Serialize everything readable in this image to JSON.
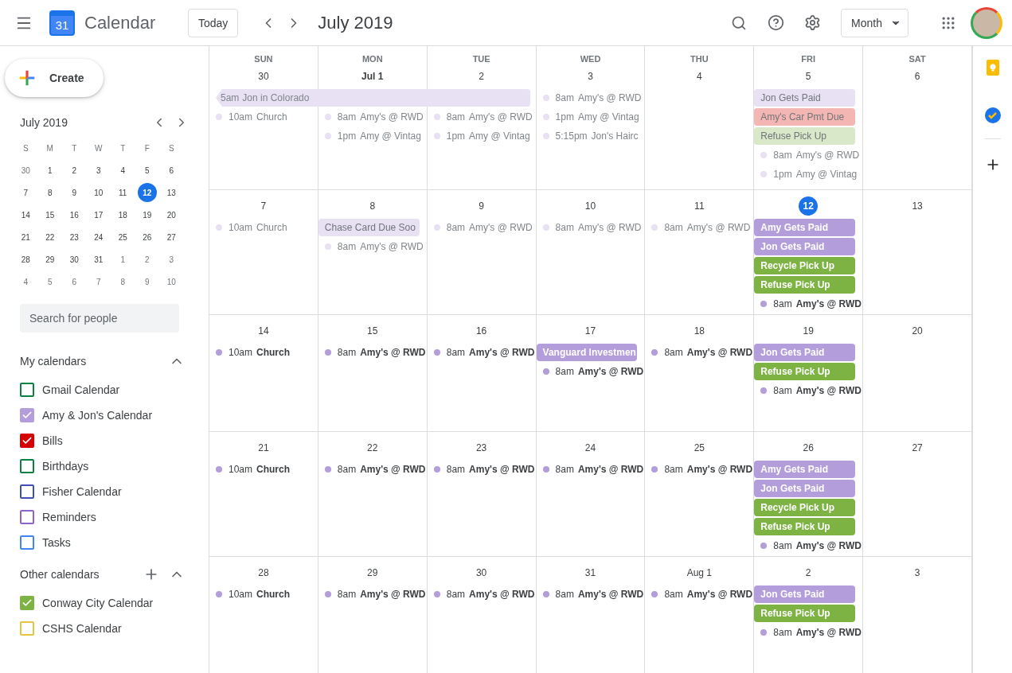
{
  "header": {
    "logo_number": "31",
    "app_name": "Calendar",
    "today_button": "Today",
    "period": "July 2019",
    "view": "Month"
  },
  "sidebar": {
    "create": "Create",
    "mini_calendar": {
      "title": "July 2019",
      "weekdays": [
        "S",
        "M",
        "T",
        "W",
        "T",
        "F",
        "S"
      ],
      "days": [
        {
          "label": "30",
          "other_month": true,
          "selected": false
        },
        {
          "label": "1",
          "other_month": false,
          "selected": false
        },
        {
          "label": "2",
          "other_month": false,
          "selected": false
        },
        {
          "label": "3",
          "other_month": false,
          "selected": false
        },
        {
          "label": "4",
          "other_month": false,
          "selected": false
        },
        {
          "label": "5",
          "other_month": false,
          "selected": false
        },
        {
          "label": "6",
          "other_month": false,
          "selected": false
        },
        {
          "label": "7",
          "other_month": false,
          "selected": false
        },
        {
          "label": "8",
          "other_month": false,
          "selected": false
        },
        {
          "label": "9",
          "other_month": false,
          "selected": false
        },
        {
          "label": "10",
          "other_month": false,
          "selected": false
        },
        {
          "label": "11",
          "other_month": false,
          "selected": false
        },
        {
          "label": "12",
          "other_month": false,
          "selected": true
        },
        {
          "label": "13",
          "other_month": false,
          "selected": false
        },
        {
          "label": "14",
          "other_month": false,
          "selected": false
        },
        {
          "label": "15",
          "other_month": false,
          "selected": false
        },
        {
          "label": "16",
          "other_month": false,
          "selected": false
        },
        {
          "label": "17",
          "other_month": false,
          "selected": false
        },
        {
          "label": "18",
          "other_month": false,
          "selected": false
        },
        {
          "label": "19",
          "other_month": false,
          "selected": false
        },
        {
          "label": "20",
          "other_month": false,
          "selected": false
        },
        {
          "label": "21",
          "other_month": false,
          "selected": false
        },
        {
          "label": "22",
          "other_month": false,
          "selected": false
        },
        {
          "label": "23",
          "other_month": false,
          "selected": false
        },
        {
          "label": "24",
          "other_month": false,
          "selected": false
        },
        {
          "label": "25",
          "other_month": false,
          "selected": false
        },
        {
          "label": "26",
          "other_month": false,
          "selected": false
        },
        {
          "label": "27",
          "other_month": false,
          "selected": false
        },
        {
          "label": "28",
          "other_month": false,
          "selected": false
        },
        {
          "label": "29",
          "other_month": false,
          "selected": false
        },
        {
          "label": "30",
          "other_month": false,
          "selected": false
        },
        {
          "label": "31",
          "other_month": false,
          "selected": false
        },
        {
          "label": "1",
          "other_month": true,
          "selected": false
        },
        {
          "label": "2",
          "other_month": true,
          "selected": false
        },
        {
          "label": "3",
          "other_month": true,
          "selected": false
        },
        {
          "label": "4",
          "other_month": true,
          "selected": false
        },
        {
          "label": "5",
          "other_month": true,
          "selected": false
        },
        {
          "label": "6",
          "other_month": true,
          "selected": false
        },
        {
          "label": "7",
          "other_month": true,
          "selected": false
        },
        {
          "label": "8",
          "other_month": true,
          "selected": false
        },
        {
          "label": "9",
          "other_month": true,
          "selected": false
        },
        {
          "label": "10",
          "other_month": true,
          "selected": false
        }
      ]
    },
    "search": {
      "placeholder": "Search for people"
    },
    "groups": [
      {
        "title": "My calendars",
        "expanded": true,
        "calendars": [
          {
            "name": "Gmail Calendar",
            "color": "#0b8043",
            "checked": false
          },
          {
            "name": "Amy & Jon's Calendar",
            "color": "#b39ddb",
            "checked": true
          },
          {
            "name": "Bills",
            "color": "#d50000",
            "checked": true
          },
          {
            "name": "Birthdays",
            "color": "#0b8043",
            "checked": false
          },
          {
            "name": "Fisher Calendar",
            "color": "#3f51b5",
            "checked": false
          },
          {
            "name": "Reminders",
            "color": "#8e63ce",
            "checked": false
          },
          {
            "name": "Tasks",
            "color": "#4285f4",
            "checked": false
          }
        ]
      },
      {
        "title": "Other calendars",
        "expanded": true,
        "add_button": true,
        "calendars": [
          {
            "name": "Conway City Calendar",
            "color": "#7cb342",
            "checked": true
          },
          {
            "name": "CSHS Calendar",
            "color": "#e4c441",
            "checked": false
          }
        ]
      }
    ]
  },
  "month": {
    "weekdays": [
      "SUN",
      "MON",
      "TUE",
      "WED",
      "THU",
      "FRI",
      "SAT"
    ],
    "weeks": [
      {
        "days": [
          {
            "date": "30",
            "today": false,
            "events": [
              {
                "kind": "span",
                "time": "5am",
                "title": "Jon in Colorado",
                "color": "#e8e1f4",
                "past": true
              },
              {
                "kind": "dot",
                "time": "10am",
                "title": "Church",
                "color": "#e8e1f4",
                "past": true
              }
            ]
          },
          {
            "date": "Jul 1",
            "today": false,
            "events": [
              {
                "kind": "continued",
                "color": "#e8e1f4"
              },
              {
                "kind": "dot",
                "time": "8am",
                "title": "Amy's @ RWD",
                "color": "#e8e1f4",
                "past": true
              },
              {
                "kind": "dot",
                "time": "1pm",
                "title": "Amy @ Vintag",
                "color": "#e8e1f4",
                "past": true
              }
            ]
          },
          {
            "date": "2",
            "today": false,
            "events": [
              {
                "kind": "continued",
                "color": "#e8e1f4"
              },
              {
                "kind": "dot",
                "time": "8am",
                "title": "Amy's @ RWD",
                "color": "#e8e1f4",
                "past": true
              },
              {
                "kind": "dot",
                "time": "1pm",
                "title": "Amy @ Vintag",
                "color": "#e8e1f4",
                "past": true
              }
            ]
          },
          {
            "date": "3",
            "today": false,
            "events": [
              {
                "kind": "dot",
                "time": "8am",
                "title": "Amy's @ RWD",
                "color": "#e8e1f4",
                "past": true
              },
              {
                "kind": "dot",
                "time": "1pm",
                "title": "Amy @ Vintag",
                "color": "#e8e1f4",
                "past": true
              },
              {
                "kind": "dot",
                "time": "5:15pm",
                "title": "Jon's Hairc",
                "color": "#e8e1f4",
                "past": true
              }
            ]
          },
          {
            "date": "4",
            "today": false
          },
          {
            "date": "5",
            "today": false,
            "events": [
              {
                "kind": "chip",
                "title": "Jon Gets Paid",
                "color": "#e8e1f4",
                "past": true
              },
              {
                "kind": "chip",
                "title": "Amy's Car Pmt Due",
                "color": "#f4b6b2",
                "past": true
              },
              {
                "kind": "chip",
                "title": "Refuse Pick Up",
                "color": "#d8e8c8",
                "past": true
              },
              {
                "kind": "dot",
                "time": "8am",
                "title": "Amy's @ RWD",
                "color": "#e8e1f4",
                "past": true
              },
              {
                "kind": "dot",
                "time": "1pm",
                "title": "Amy @ Vintag",
                "color": "#e8e1f4",
                "past": true
              }
            ]
          },
          {
            "date": "6",
            "today": false
          }
        ]
      },
      {
        "days": [
          {
            "date": "7",
            "today": false,
            "events": [
              {
                "kind": "dot",
                "time": "10am",
                "title": "Church",
                "color": "#e8e1f4",
                "past": true
              }
            ]
          },
          {
            "date": "8",
            "today": false,
            "events": [
              {
                "kind": "chip",
                "title": "Chase Card Due Soo",
                "color": "#e8e1f4",
                "past": true
              },
              {
                "kind": "dot",
                "time": "8am",
                "title": "Amy's @ RWD",
                "color": "#e8e1f4",
                "past": true
              }
            ]
          },
          {
            "date": "9",
            "today": false,
            "events": [
              {
                "kind": "dot",
                "time": "8am",
                "title": "Amy's @ RWD",
                "color": "#e8e1f4",
                "past": true
              }
            ]
          },
          {
            "date": "10",
            "today": false,
            "events": [
              {
                "kind": "dot",
                "time": "8am",
                "title": "Amy's @ RWD",
                "color": "#e8e1f4",
                "past": true
              }
            ]
          },
          {
            "date": "11",
            "today": false,
            "events": [
              {
                "kind": "dot",
                "time": "8am",
                "title": "Amy's @ RWD",
                "color": "#e8e1f4",
                "past": true
              }
            ]
          },
          {
            "date": "12",
            "today": true,
            "events": [
              {
                "kind": "chip",
                "title": "Amy Gets Paid",
                "color": "#b39ddb",
                "past": false
              },
              {
                "kind": "chip",
                "title": "Jon Gets Paid",
                "color": "#b39ddb",
                "past": false
              },
              {
                "kind": "chip",
                "title": "Recycle Pick Up",
                "color": "#7cb342",
                "past": false
              },
              {
                "kind": "chip",
                "title": "Refuse Pick Up",
                "color": "#7cb342",
                "past": false
              },
              {
                "kind": "dot",
                "time": "8am",
                "title": "Amy's @ RWD",
                "color": "#b39ddb",
                "past": false
              }
            ]
          },
          {
            "date": "13",
            "today": false
          }
        ]
      },
      {
        "days": [
          {
            "date": "14",
            "today": false,
            "events": [
              {
                "kind": "dot",
                "time": "10am",
                "title": "Church",
                "color": "#b39ddb",
                "past": false
              }
            ]
          },
          {
            "date": "15",
            "today": false,
            "events": [
              {
                "kind": "dot",
                "time": "8am",
                "title": "Amy's @ RWD",
                "color": "#b39ddb",
                "past": false
              }
            ]
          },
          {
            "date": "16",
            "today": false,
            "events": [
              {
                "kind": "dot",
                "time": "8am",
                "title": "Amy's @ RWD",
                "color": "#b39ddb",
                "past": false
              }
            ]
          },
          {
            "date": "17",
            "today": false,
            "events": [
              {
                "kind": "chip",
                "title": "Vanguard Investmen",
                "color": "#b39ddb",
                "past": false
              },
              {
                "kind": "dot",
                "time": "8am",
                "title": "Amy's @ RWD",
                "color": "#b39ddb",
                "past": false
              }
            ]
          },
          {
            "date": "18",
            "today": false,
            "events": [
              {
                "kind": "dot",
                "time": "8am",
                "title": "Amy's @ RWD",
                "color": "#b39ddb",
                "past": false
              }
            ]
          },
          {
            "date": "19",
            "today": false,
            "events": [
              {
                "kind": "chip",
                "title": "Jon Gets Paid",
                "color": "#b39ddb",
                "past": false
              },
              {
                "kind": "chip",
                "title": "Refuse Pick Up",
                "color": "#7cb342",
                "past": false
              },
              {
                "kind": "dot",
                "time": "8am",
                "title": "Amy's @ RWD",
                "color": "#b39ddb",
                "past": false
              }
            ]
          },
          {
            "date": "20",
            "today": false
          }
        ]
      },
      {
        "days": [
          {
            "date": "21",
            "today": false,
            "events": [
              {
                "kind": "dot",
                "time": "10am",
                "title": "Church",
                "color": "#b39ddb",
                "past": false
              }
            ]
          },
          {
            "date": "22",
            "today": false,
            "events": [
              {
                "kind": "dot",
                "time": "8am",
                "title": "Amy's @ RWD",
                "color": "#b39ddb",
                "past": false
              }
            ]
          },
          {
            "date": "23",
            "today": false,
            "events": [
              {
                "kind": "dot",
                "time": "8am",
                "title": "Amy's @ RWD",
                "color": "#b39ddb",
                "past": false
              }
            ]
          },
          {
            "date": "24",
            "today": false,
            "events": [
              {
                "kind": "dot",
                "time": "8am",
                "title": "Amy's @ RWD",
                "color": "#b39ddb",
                "past": false
              }
            ]
          },
          {
            "date": "25",
            "today": false,
            "events": [
              {
                "kind": "dot",
                "time": "8am",
                "title": "Amy's @ RWD",
                "color": "#b39ddb",
                "past": false
              }
            ]
          },
          {
            "date": "26",
            "today": false,
            "events": [
              {
                "kind": "chip",
                "title": "Amy Gets Paid",
                "color": "#b39ddb",
                "past": false
              },
              {
                "kind": "chip",
                "title": "Jon Gets Paid",
                "color": "#b39ddb",
                "past": false
              },
              {
                "kind": "chip",
                "title": "Recycle Pick Up",
                "color": "#7cb342",
                "past": false
              },
              {
                "kind": "chip",
                "title": "Refuse Pick Up",
                "color": "#7cb342",
                "past": false
              },
              {
                "kind": "dot",
                "time": "8am",
                "title": "Amy's @ RWD",
                "color": "#b39ddb",
                "past": false
              }
            ]
          },
          {
            "date": "27",
            "today": false
          }
        ]
      },
      {
        "days": [
          {
            "date": "28",
            "today": false,
            "events": [
              {
                "kind": "dot",
                "time": "10am",
                "title": "Church",
                "color": "#b39ddb",
                "past": false
              }
            ]
          },
          {
            "date": "29",
            "today": false,
            "events": [
              {
                "kind": "dot",
                "time": "8am",
                "title": "Amy's @ RWD",
                "color": "#b39ddb",
                "past": false
              }
            ]
          },
          {
            "date": "30",
            "today": false,
            "events": [
              {
                "kind": "dot",
                "time": "8am",
                "title": "Amy's @ RWD",
                "color": "#b39ddb",
                "past": false
              }
            ]
          },
          {
            "date": "31",
            "today": false,
            "events": [
              {
                "kind": "dot",
                "time": "8am",
                "title": "Amy's @ RWD",
                "color": "#b39ddb",
                "past": false
              }
            ]
          },
          {
            "date": "Aug 1",
            "today": false,
            "events": [
              {
                "kind": "dot",
                "time": "8am",
                "title": "Amy's @ RWD",
                "color": "#b39ddb",
                "past": false
              }
            ]
          },
          {
            "date": "2",
            "today": false,
            "events": [
              {
                "kind": "chip",
                "title": "Jon Gets Paid",
                "color": "#b39ddb",
                "past": false
              },
              {
                "kind": "chip",
                "title": "Refuse Pick Up",
                "color": "#7cb342",
                "past": false
              },
              {
                "kind": "dot",
                "time": "8am",
                "title": "Amy's @ RWD",
                "color": "#b39ddb",
                "past": false
              }
            ]
          },
          {
            "date": "3",
            "today": false
          }
        ]
      }
    ]
  }
}
